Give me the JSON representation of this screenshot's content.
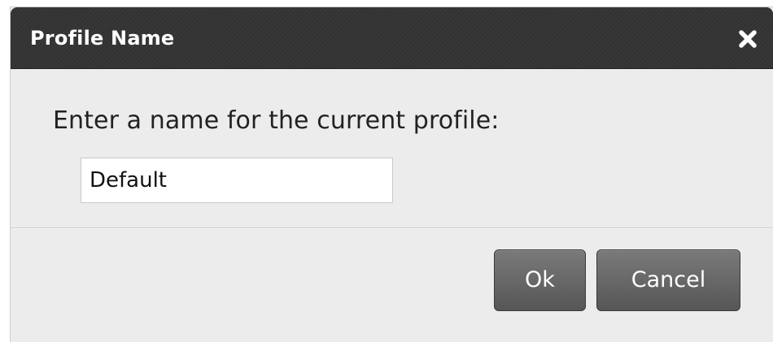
{
  "dialog": {
    "title": "Profile Name",
    "close_icon": "close-x-icon",
    "prompt": "Enter a name for the current profile:",
    "input_value": "Default",
    "ok_label": "Ok",
    "cancel_label": "Cancel"
  },
  "colors": {
    "titlebar": "#333333",
    "title_text": "#ffffff",
    "body_background": "#ececec",
    "button": "#5f5f5f",
    "button_text": "#ffffff"
  }
}
